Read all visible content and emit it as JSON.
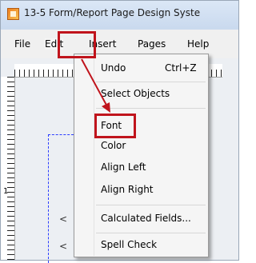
{
  "window": {
    "title": "13-5 Form/Report Page Design Syste"
  },
  "menubar": [
    "File",
    "Edit",
    "Insert",
    "Pages",
    "Help"
  ],
  "edit_menu": {
    "items": [
      {
        "label": "Undo",
        "shortcut": "Ctrl+Z"
      },
      {
        "label": "Select Objects"
      },
      {
        "label": "Font"
      },
      {
        "label": "Color"
      },
      {
        "label": "Align Left"
      },
      {
        "label": "Align Right"
      },
      {
        "label": "Calculated Fields..."
      },
      {
        "label": "Spell Check"
      }
    ]
  },
  "ruler": {
    "number": "1"
  },
  "canvas_objects": [
    "<",
    "<"
  ],
  "colors": {
    "highlight": "#c0141c",
    "guide": "#2a3cff",
    "menubar": "#f0f0f0"
  }
}
